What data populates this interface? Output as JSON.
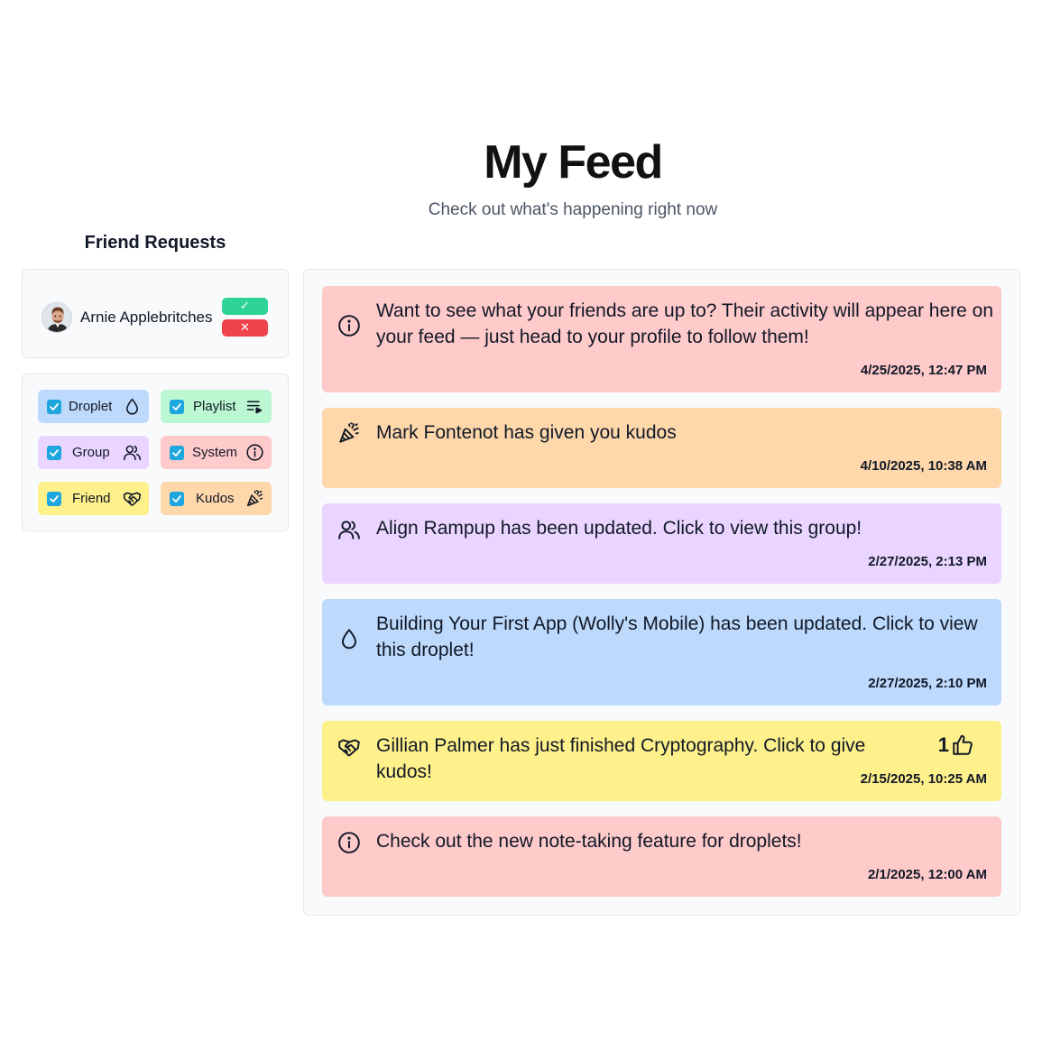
{
  "header": {
    "title": "My Feed",
    "subtitle": "Check out what's happening right now"
  },
  "friend_requests": {
    "heading": "Friend Requests",
    "items": [
      {
        "name": "Arnie Applebritches",
        "accept_label": "✓",
        "reject_label": "✕"
      }
    ]
  },
  "filters": [
    {
      "label": "Droplet",
      "checked": true,
      "icon": "droplet-icon",
      "color": "#bdd9fb"
    },
    {
      "label": "Playlist",
      "checked": true,
      "icon": "playlist-icon",
      "color": "#bbf7d0"
    },
    {
      "label": "Group",
      "checked": true,
      "icon": "users-icon",
      "color": "#e9d5ff"
    },
    {
      "label": "System",
      "checked": true,
      "icon": "info-icon",
      "color": "#fecaca"
    },
    {
      "label": "Friend",
      "checked": true,
      "icon": "handshake-icon",
      "color": "#fef08a"
    },
    {
      "label": "Kudos",
      "checked": true,
      "icon": "party-popper-icon",
      "color": "#fed7aa"
    }
  ],
  "feed": [
    {
      "type": "system",
      "icon": "info-icon",
      "color": "#fecaca",
      "text": "Want to see what your friends are up to? Their activity will appear here on your feed — just head to your profile to follow them!",
      "date": "4/25/2025, 12:47 PM"
    },
    {
      "type": "kudos",
      "icon": "party-popper-icon",
      "color": "#fed7aa",
      "text": "Mark Fontenot has given you kudos",
      "date": "4/10/2025, 10:38 AM"
    },
    {
      "type": "group",
      "icon": "users-icon",
      "color": "#e9d5ff",
      "text": "Align Rampup has been updated. Click to view this group!",
      "date": "2/27/2025, 2:13 PM"
    },
    {
      "type": "droplet",
      "icon": "droplet-icon",
      "color": "#bdd9fb",
      "text": "Building Your First App (Wolly's Mobile) has been updated. Click to view this droplet!",
      "date": "2/27/2025, 2:10 PM"
    },
    {
      "type": "friend",
      "icon": "handshake-icon",
      "color": "#fef08a",
      "text": "Gillian Palmer has just finished Cryptography. Click to give kudos!",
      "date": "2/15/2025, 10:25 AM",
      "kudos_count": "1"
    },
    {
      "type": "system",
      "icon": "info-icon",
      "color": "#fecaca",
      "text": "Check out the new note-taking feature for droplets!",
      "date": "2/1/2025, 12:00 AM"
    }
  ]
}
